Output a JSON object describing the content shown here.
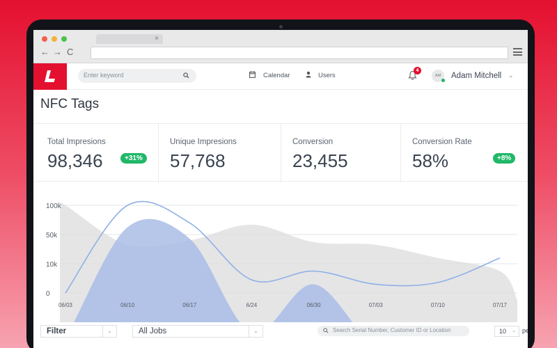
{
  "browser": {
    "tab_close": "×",
    "nav": {
      "back": "←",
      "forward": "→",
      "reload": "C"
    }
  },
  "header": {
    "search_placeholder": "Enter keyword",
    "calendar_label": "Calendar",
    "users_label": "Users",
    "notification_count": "4",
    "avatar_initials": "AM",
    "user_name": "Adam Mitchell"
  },
  "page": {
    "title": "NFC Tags"
  },
  "stats": [
    {
      "label": "Total Impresions",
      "value": "98,346",
      "badge": "+31%"
    },
    {
      "label": "Unique Impresions",
      "value": "57,768",
      "badge": ""
    },
    {
      "label": "Conversion",
      "value": "23,455",
      "badge": ""
    },
    {
      "label": "Conversion Rate",
      "value": "58%",
      "badge": "+8%"
    }
  ],
  "colors": {
    "brand_red": "#e4102f",
    "badge_green": "#20b868",
    "area_blue": "#a9bde6",
    "line_blue": "#8fb0e6",
    "area_gray": "#dcdcde"
  },
  "chart_data": {
    "type": "area",
    "x": [
      "06/03",
      "06/10",
      "06/17",
      "6/24",
      "06/30",
      "07/03",
      "07/10",
      "07/17"
    ],
    "y_ticks": [
      "100k",
      "50k",
      "10k",
      "0"
    ],
    "grid": true,
    "series": [
      {
        "style": "gray-area",
        "values": [
          100,
          55,
          60,
          78,
          58,
          55,
          40,
          25
        ]
      },
      {
        "style": "blue-line",
        "values": [
          0,
          100,
          80,
          15,
          25,
          10,
          12,
          40
        ]
      },
      {
        "style": "blue-area",
        "values": [
          -50,
          75,
          62,
          -45,
          10,
          -60,
          -60,
          -40
        ]
      }
    ]
  },
  "filters": {
    "filter_label": "Filter",
    "jobs_label": "All Jobs",
    "search_placeholder": "Search Serial Number, Customer ID or  Location",
    "per_page": "10",
    "per_page_suffix": "pe"
  }
}
